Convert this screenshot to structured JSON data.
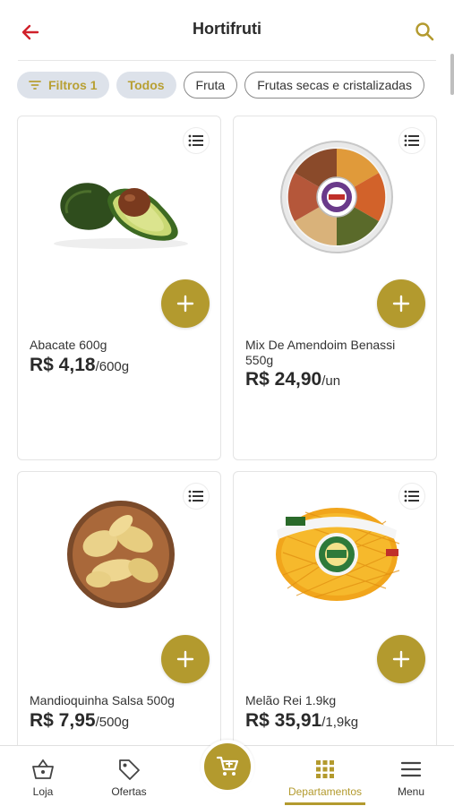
{
  "header": {
    "title": "Hortifruti",
    "back_icon": "arrow-left-icon",
    "search_icon": "search-icon",
    "accent_color": "#b39a2e",
    "back_color": "#d0202a"
  },
  "chips": [
    {
      "label": "Filtros",
      "count": "1",
      "style": "filled",
      "icon": "filter-icon"
    },
    {
      "label": "Todos",
      "style": "filled"
    },
    {
      "label": "Fruta",
      "style": "outline"
    },
    {
      "label": "Frutas secas e cristalizadas",
      "style": "outline"
    }
  ],
  "products": [
    {
      "name": "Abacate 600g",
      "price": "R$ 4,18",
      "unit": "/600g",
      "image": "avocado"
    },
    {
      "name": "Mix De Amendoim Benassi 550g",
      "price": "R$ 24,90",
      "unit": "/un",
      "image": "peanut-mix-tray"
    },
    {
      "name": "Mandioquinha Salsa 500g",
      "price": "R$ 7,95",
      "unit": "/500g",
      "image": "root-vegetable-bowl"
    },
    {
      "name": "Melão Rei 1.9kg",
      "price": "R$ 35,91",
      "unit": "/1,9kg",
      "image": "yellow-melon"
    }
  ],
  "bottom_nav": {
    "items": [
      {
        "label": "Loja",
        "icon": "basket-icon"
      },
      {
        "label": "Ofertas",
        "icon": "tag-icon"
      },
      {
        "label": "Departamentos",
        "icon": "grid-icon",
        "active": true
      },
      {
        "label": "Menu",
        "icon": "menu-icon"
      }
    ],
    "cart_icon": "cart-icon"
  }
}
